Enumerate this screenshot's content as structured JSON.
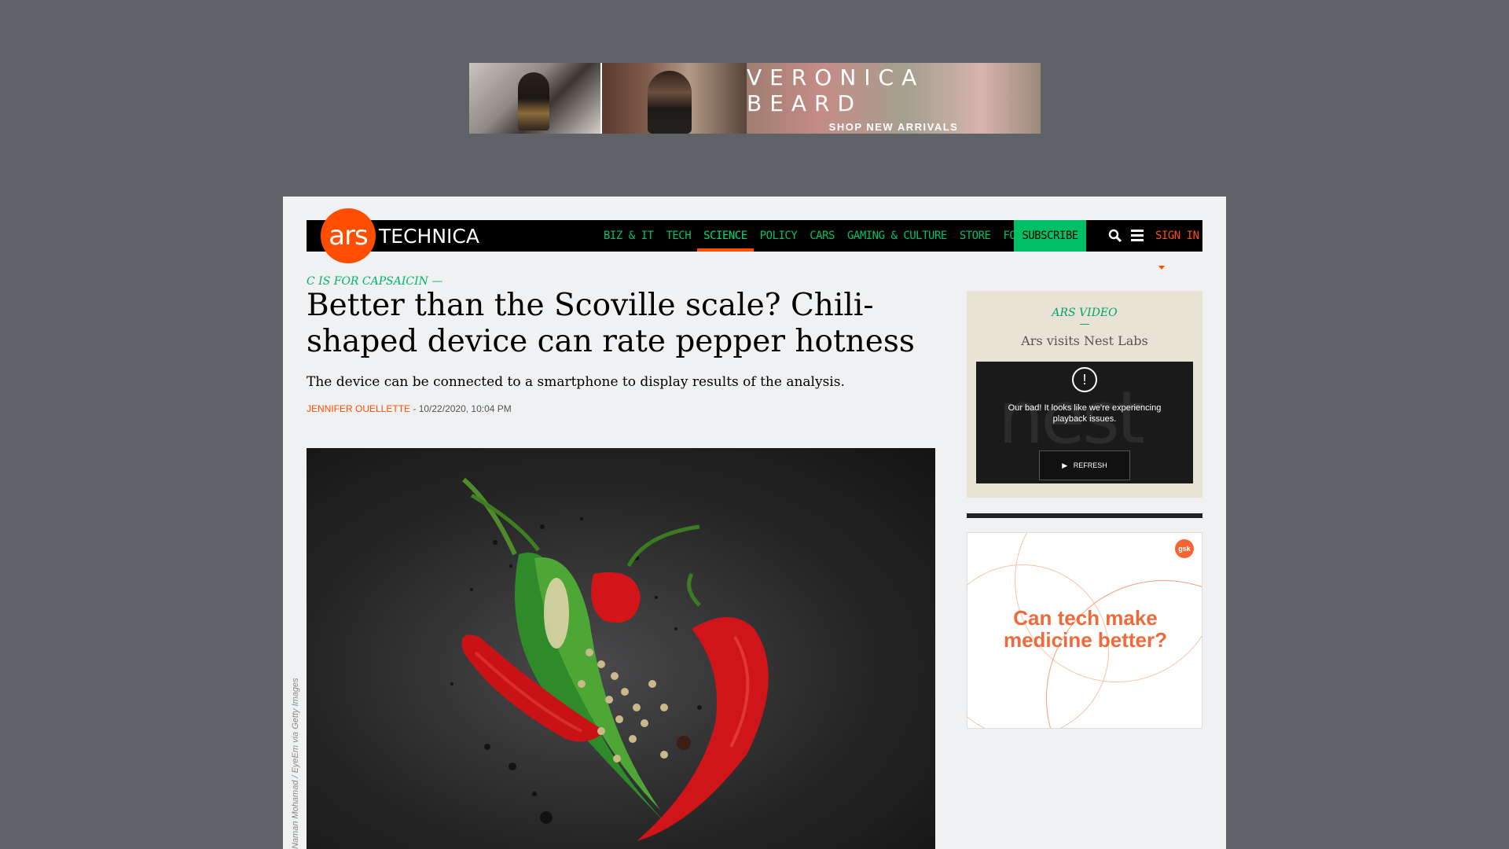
{
  "top_ad": {
    "brand": "VERONICA BEARD",
    "cta": "SHOP NEW ARRIVALS"
  },
  "header": {
    "logo_mark": "ars",
    "logo_word": "TECHNICA",
    "nav": [
      {
        "label": "Biz & IT"
      },
      {
        "label": "Tech"
      },
      {
        "label": "Science"
      },
      {
        "label": "Policy"
      },
      {
        "label": "Cars"
      },
      {
        "label": "Gaming & Culture"
      },
      {
        "label": "Store"
      },
      {
        "label": "Forums"
      }
    ],
    "active_nav": "Science",
    "subscribe": "SUBSCRIBE",
    "signin": "SIGN IN",
    "colors": {
      "accent": "#ff4e00",
      "green": "#00c066"
    }
  },
  "article": {
    "kicker": "C is for capsaicin —",
    "headline": "Better than the Scoville scale? Chili-shaped device can rate pepper hotness",
    "dek": "The device can be connected to a smartphone to display results of the analysis.",
    "author": "Jennifer Ouellette",
    "separator": " - ",
    "timestamp": "10/22/2020, 10:04 PM",
    "image_credit": "Naman Mohamad / EyeEm via Getty Images"
  },
  "sidebar": {
    "video_label": "ARS VIDEO",
    "video_title": "Ars visits Nest Labs",
    "player_bg": "nest",
    "player_alert": "!",
    "player_message": "Our bad! It looks like we're experiencing playback issues.",
    "refresh_label": "REFRESH",
    "ad_text": "Can tech make medicine better?",
    "ad_logo": "gsk"
  }
}
